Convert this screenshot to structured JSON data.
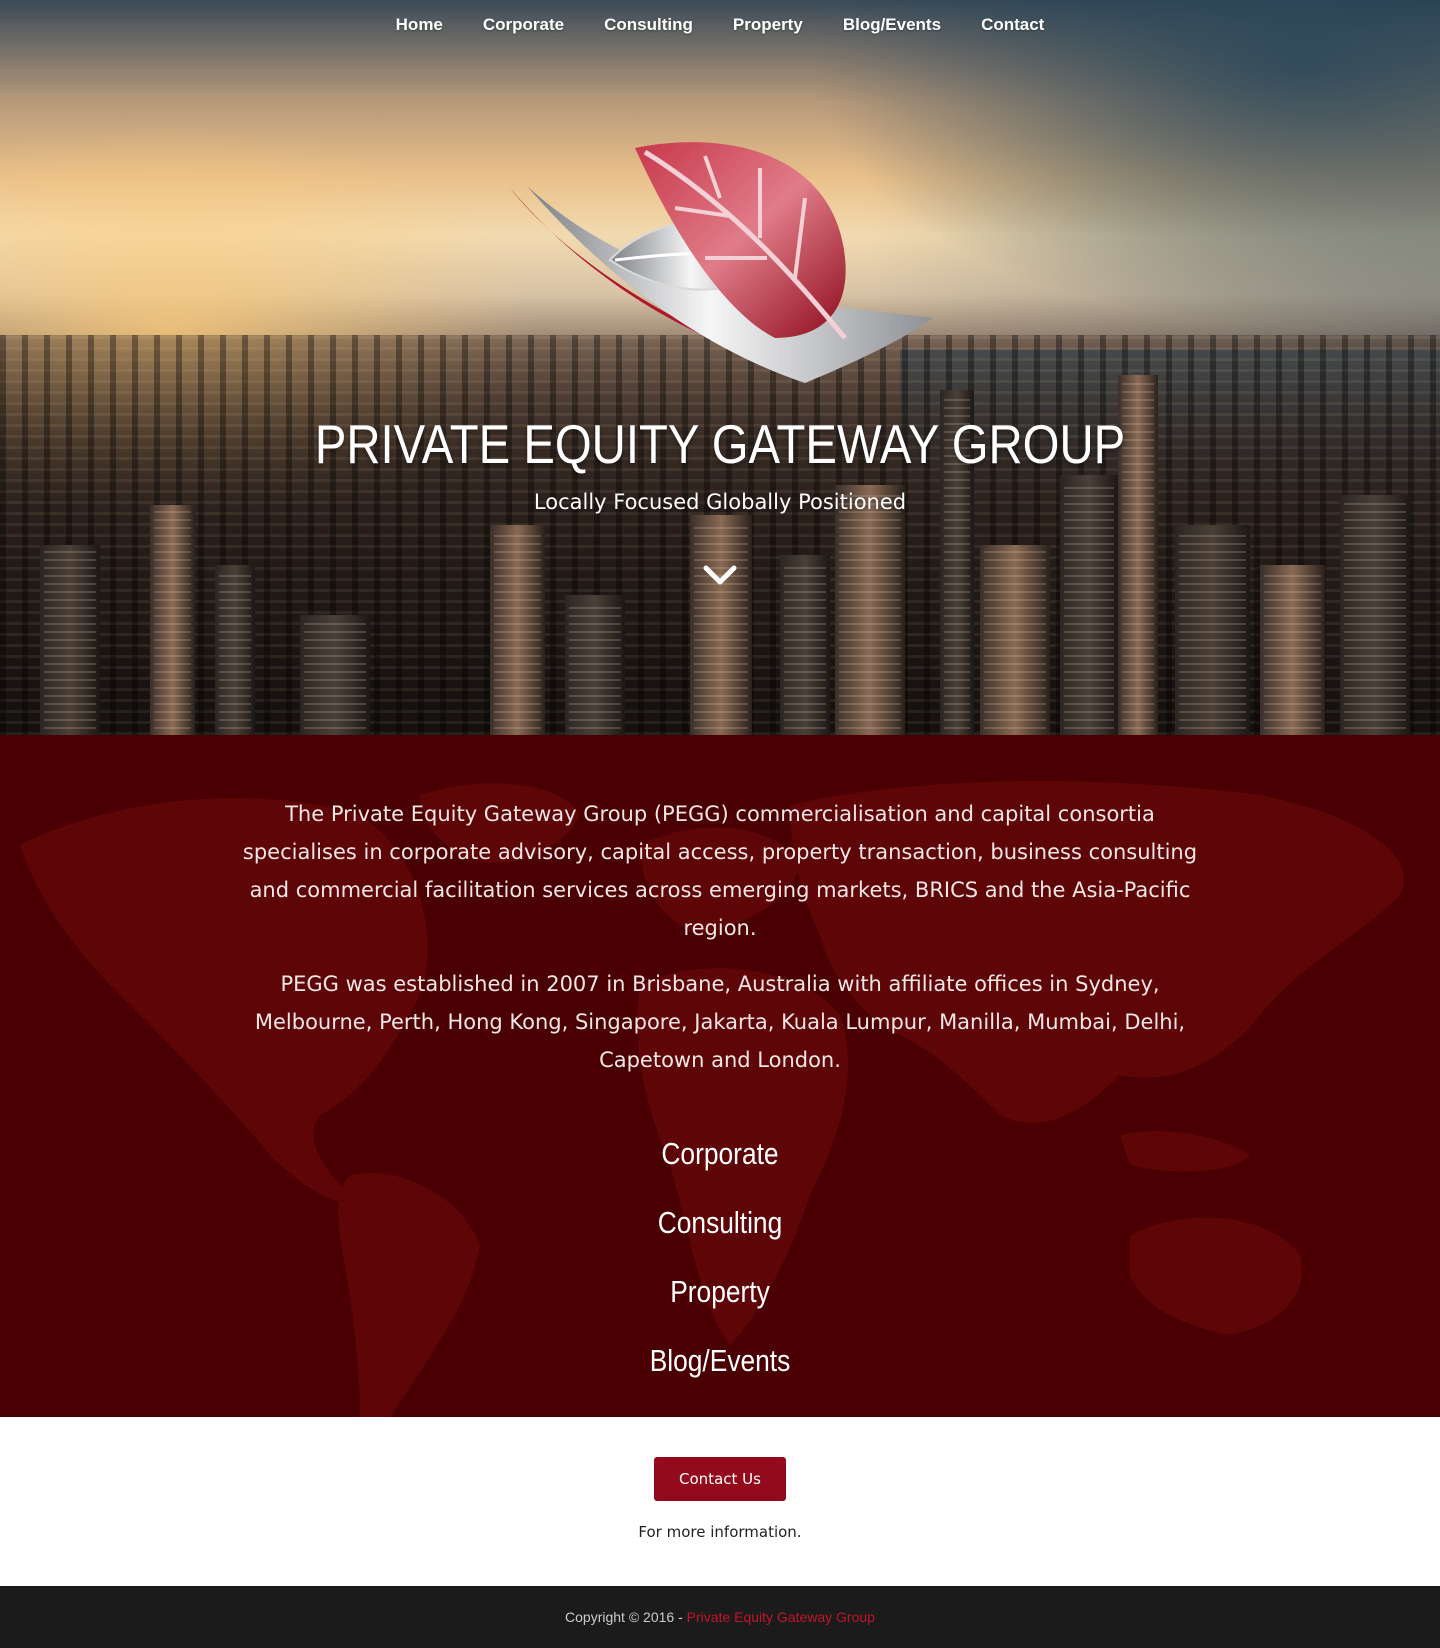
{
  "nav": {
    "items": [
      {
        "label": "Home"
      },
      {
        "label": "Corporate"
      },
      {
        "label": "Consulting"
      },
      {
        "label": "Property"
      },
      {
        "label": "Blog/Events"
      },
      {
        "label": "Contact"
      }
    ]
  },
  "hero": {
    "title": "PRIVATE EQUITY GATEWAY GROUP",
    "tagline": "Locally Focused Globally Positioned",
    "logo_icon": "leaf-logo-icon",
    "scroll_icon": "chevron-down-icon"
  },
  "about": {
    "paragraphs": [
      "The Private Equity Gateway Group (PEGG) commercialisation and capital consortia specialises in corporate advisory, capital access, property transaction, business consulting and commercial facilitation services across emerging markets, BRICS and the Asia-Pacific region.",
      "PEGG was established in 2007 in Brisbane, Australia with affiliate offices in Sydney, Melbourne, Perth, Hong Kong, Singapore, Jakarta, Kuala Lumpur, Manilla, Mumbai, Delhi, Capetown and London."
    ],
    "services": [
      {
        "label": "Corporate"
      },
      {
        "label": "Consulting"
      },
      {
        "label": "Property"
      },
      {
        "label": "Blog/Events"
      }
    ]
  },
  "cta": {
    "button_label": "Contact Us",
    "note": "For more information."
  },
  "footer": {
    "copyright": "Copyright © 2016 -",
    "brand": "Private Equity Gateway Group"
  },
  "colors": {
    "accent": "#930a1c",
    "about_bg": "#4a0002",
    "footer_bg": "#1b1b1b",
    "footer_brand": "#c0152a"
  }
}
